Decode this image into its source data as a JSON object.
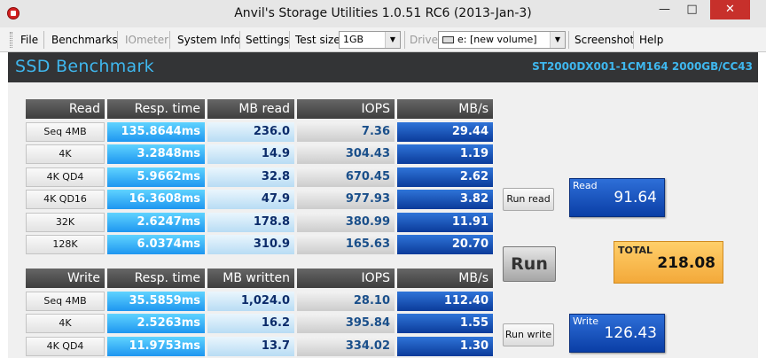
{
  "window": {
    "title": "Anvil's Storage Utilities 1.0.51 RC6 (2013-Jan-3)",
    "minimize": "—",
    "maximize": "□",
    "close": "✕"
  },
  "menu": {
    "file": "File",
    "benchmarks": "Benchmarks",
    "iometer": "IOmeter",
    "system_info": "System Info",
    "settings": "Settings",
    "test_size_label": "Test size",
    "test_size_value": "1GB",
    "drive_label": "Drive",
    "drive_value": "e: [new volume]",
    "screenshot": "Screenshot",
    "help": "Help"
  },
  "header": {
    "title": "SSD Benchmark",
    "model": "ST2000DX001-1CM164 2000GB/CC43"
  },
  "read": {
    "headers": [
      "Read",
      "Resp. time",
      "MB read",
      "IOPS",
      "MB/s"
    ],
    "rows": [
      [
        "Seq 4MB",
        "135.8644ms",
        "236.0",
        "7.36",
        "29.44"
      ],
      [
        "4K",
        "3.2848ms",
        "14.9",
        "304.43",
        "1.19"
      ],
      [
        "4K QD4",
        "5.9662ms",
        "32.8",
        "670.45",
        "2.62"
      ],
      [
        "4K QD16",
        "16.3608ms",
        "47.9",
        "977.93",
        "3.82"
      ],
      [
        "32K",
        "2.6247ms",
        "178.8",
        "380.99",
        "11.91"
      ],
      [
        "128K",
        "6.0374ms",
        "310.9",
        "165.63",
        "20.70"
      ]
    ]
  },
  "write": {
    "headers": [
      "Write",
      "Resp. time",
      "MB written",
      "IOPS",
      "MB/s"
    ],
    "rows": [
      [
        "Seq 4MB",
        "35.5859ms",
        "1,024.0",
        "28.10",
        "112.40"
      ],
      [
        "4K",
        "2.5263ms",
        "16.2",
        "395.84",
        "1.55"
      ],
      [
        "4K QD4",
        "11.9753ms",
        "13.7",
        "334.02",
        "1.30"
      ]
    ]
  },
  "buttons": {
    "run_read": "Run read",
    "run": "Run",
    "run_write": "Run write"
  },
  "results": {
    "read_label": "Read",
    "read_value": "91.64",
    "total_label": "TOTAL",
    "total_value": "218.08",
    "write_label": "Write",
    "write_value": "126.43"
  }
}
